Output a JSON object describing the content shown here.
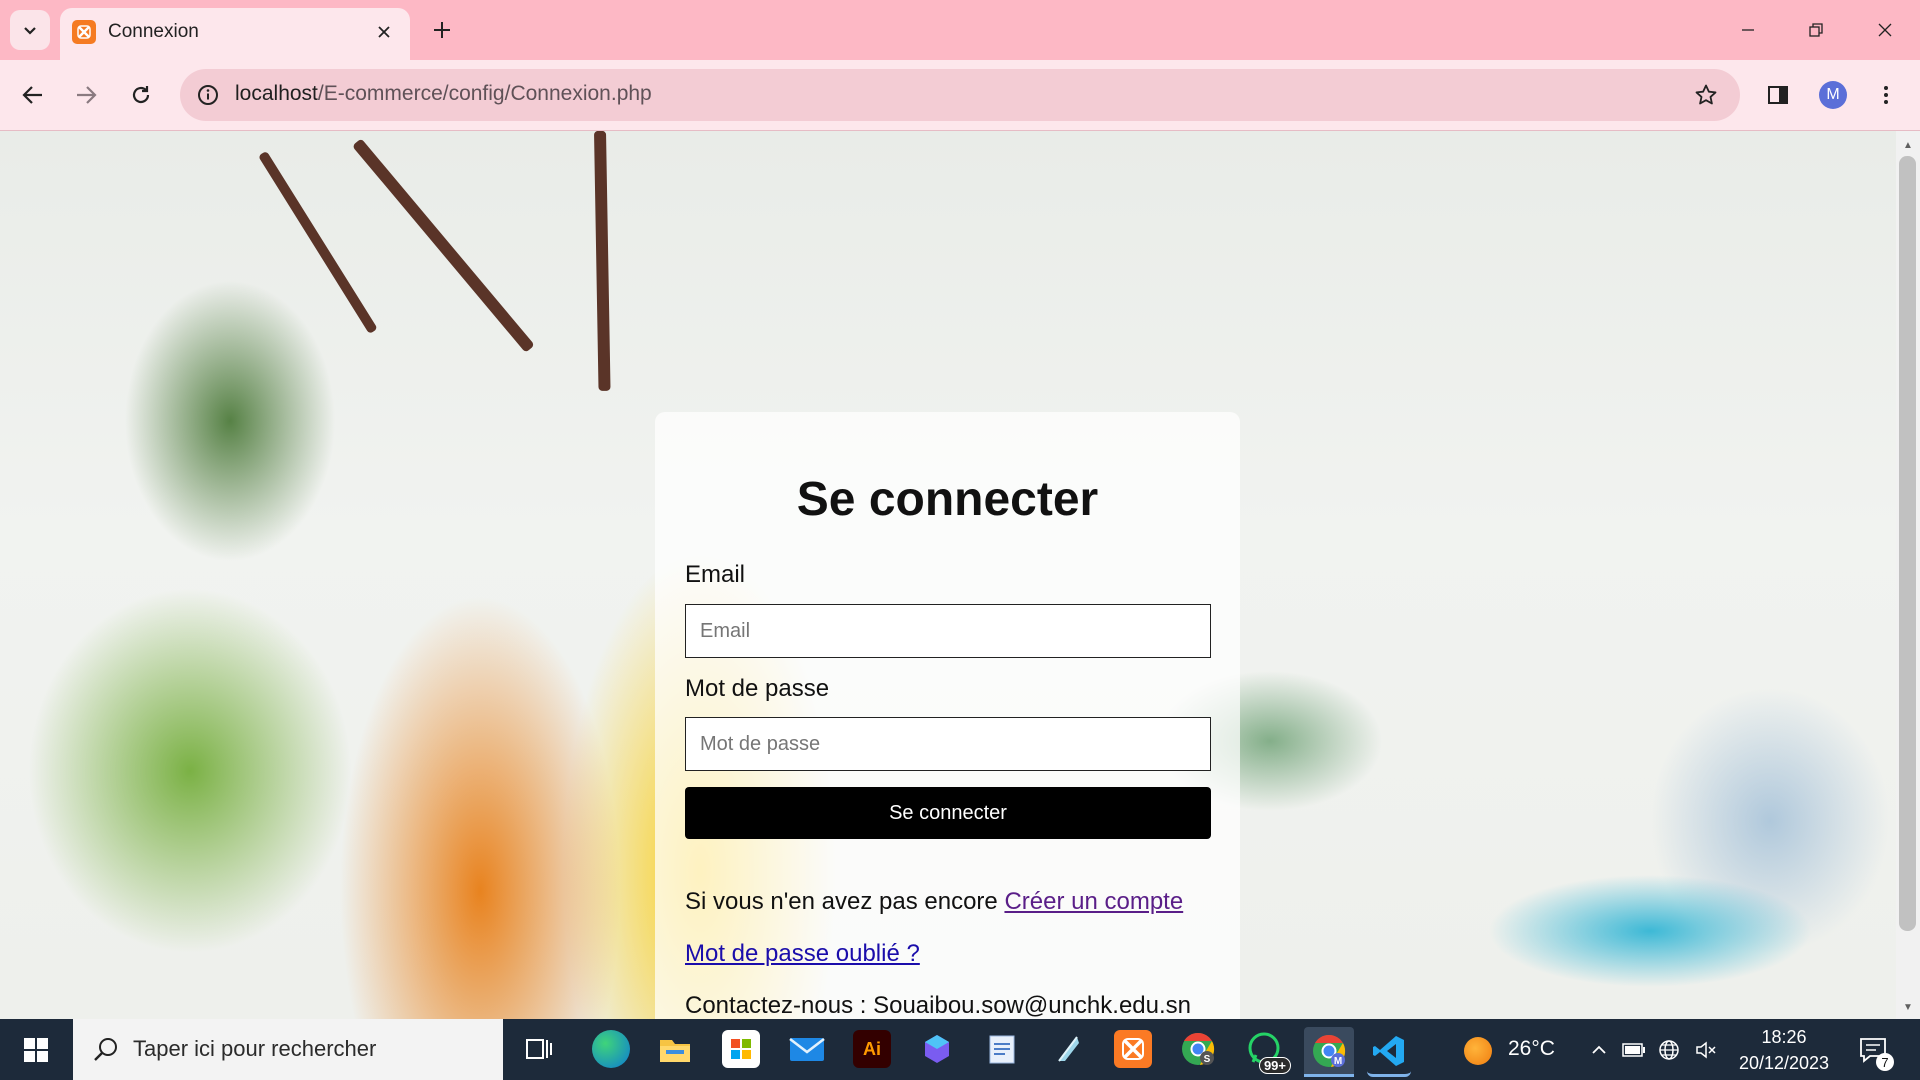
{
  "browser": {
    "tab_title": "Connexion",
    "url_host": "localhost",
    "url_path": "/E-commerce/config/Connexion.php",
    "profile_initial": "M",
    "accent_color": "#fdb8c5"
  },
  "login": {
    "title": "Se connecter",
    "email_label": "Email",
    "email_placeholder": "Email",
    "password_label": "Mot de passe",
    "password_placeholder": "Mot de passe",
    "submit_label": "Se connecter",
    "no_account_text": "Si vous n'en avez pas encore",
    "create_account_link": "Créer un compte",
    "forgot_password_link": "Mot de passe oublié ?",
    "contact_text": "Contactez-nous : Souaibou.sow@unchk.edu.sn"
  },
  "taskbar": {
    "search_placeholder": "Taper ici pour rechercher",
    "whatsapp_badge": "99+",
    "weather": "26°C",
    "time": "18:26",
    "date": "20/12/2023",
    "notification_count": "7",
    "icons": [
      "task-view-icon",
      "edge-icon",
      "file-explorer-icon",
      "store-icon",
      "mail-icon",
      "illustrator-icon",
      "copilot-icon",
      "notepad-icon",
      "feather-app-icon",
      "xampp-icon",
      "chrome-profile-s-icon",
      "whatsapp-icon",
      "chrome-profile-m-icon",
      "vscode-icon"
    ]
  }
}
